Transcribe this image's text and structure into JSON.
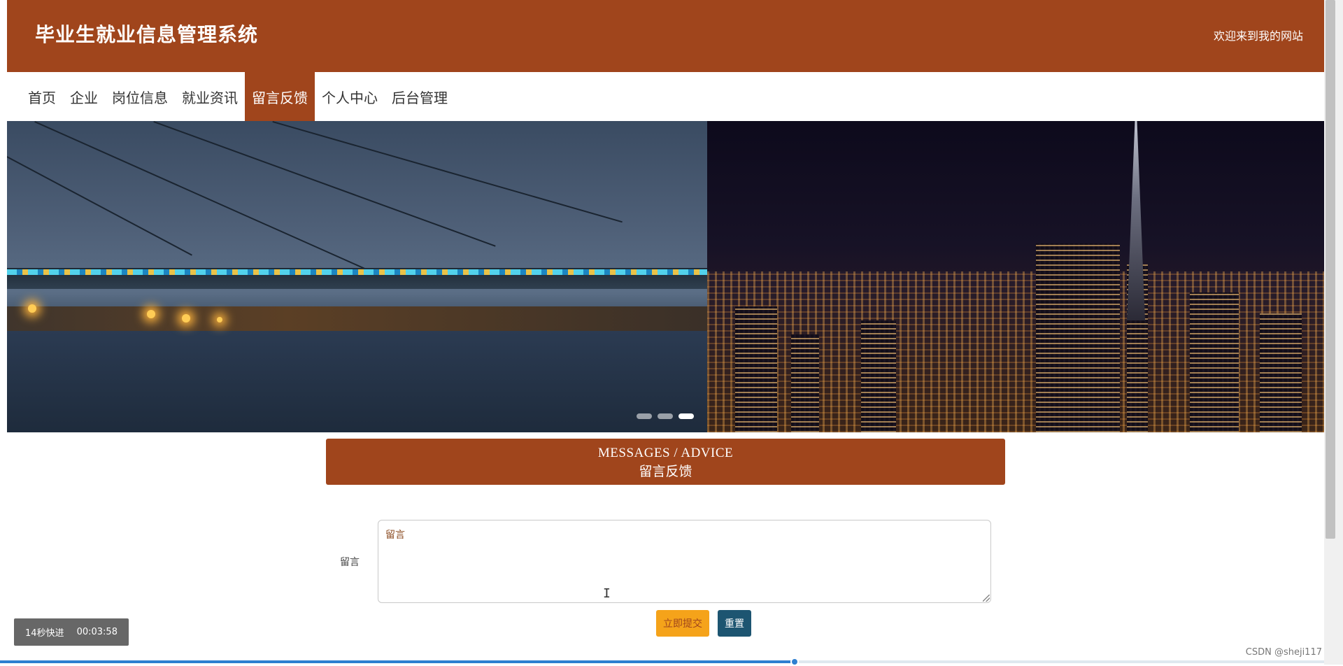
{
  "header": {
    "site_title": "毕业生就业信息管理系统",
    "welcome_text": "欢迎来到我的网站",
    "background_color": "#a0451c"
  },
  "nav": {
    "items": [
      {
        "label": "首页",
        "active": false
      },
      {
        "label": "企业",
        "active": false
      },
      {
        "label": "岗位信息",
        "active": false
      },
      {
        "label": "就业资讯",
        "active": false
      },
      {
        "label": "留言反馈",
        "active": true
      },
      {
        "label": "个人中心",
        "active": false
      },
      {
        "label": "后台管理",
        "active": false
      }
    ]
  },
  "banner": {
    "slides_count": 3,
    "active_slide": 3
  },
  "section": {
    "title_en": "MESSAGES / ADVICE",
    "title_cn": "留言反馈"
  },
  "form": {
    "label": "留言",
    "textarea_value": "留言",
    "submit_label": "立即提交",
    "reset_label": "重置",
    "submit_color": "#f5a31a",
    "reset_color": "#1d5571"
  },
  "player": {
    "skip_text": "14秒快进",
    "time_text": "00:03:58",
    "progress_fraction": 0.6
  },
  "watermark": "CSDN @sheji117"
}
